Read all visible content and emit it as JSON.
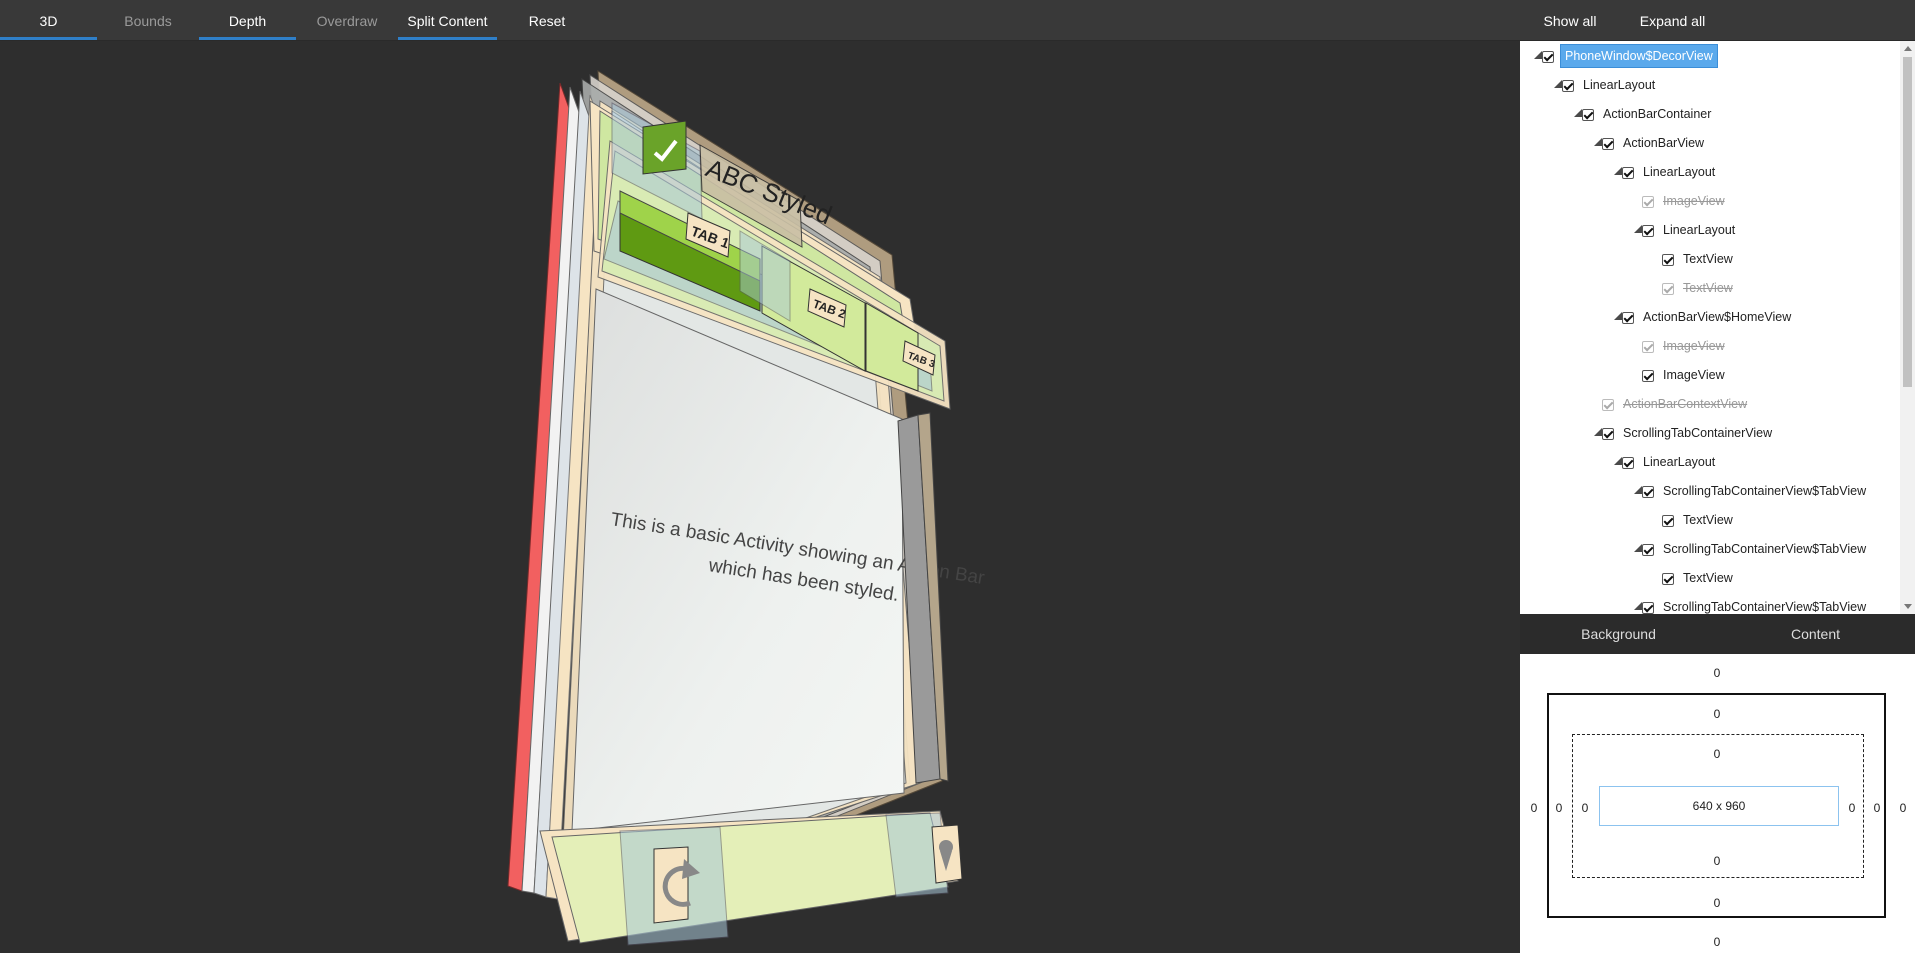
{
  "toolbar": {
    "left_buttons": [
      {
        "label": "3D",
        "active": true
      },
      {
        "label": "Bounds",
        "active": false
      },
      {
        "label": "Depth",
        "active": true
      },
      {
        "label": "Overdraw",
        "active": false
      },
      {
        "label": "Split Content",
        "active": true
      },
      {
        "label": "Reset",
        "active": false
      }
    ],
    "show_all": "Show all",
    "expand_all": "Expand all"
  },
  "scene": {
    "title": "ABC Styled",
    "tabs": [
      "TAB 1",
      "TAB 2",
      "TAB 3"
    ],
    "body_line1": "This is a basic Activity showing an Action Bar",
    "body_line2": "which has been styled."
  },
  "tree": {
    "nodes": [
      {
        "label": "PhoneWindow$DecorView",
        "depth": 0,
        "expandable": true,
        "checked": true,
        "hidden": false,
        "selected": true
      },
      {
        "label": "LinearLayout",
        "depth": 1,
        "expandable": true,
        "checked": true,
        "hidden": false
      },
      {
        "label": "ActionBarContainer",
        "depth": 2,
        "expandable": true,
        "checked": true,
        "hidden": false
      },
      {
        "label": "ActionBarView",
        "depth": 3,
        "expandable": true,
        "checked": true,
        "hidden": false
      },
      {
        "label": "LinearLayout",
        "depth": 4,
        "expandable": true,
        "checked": true,
        "hidden": false
      },
      {
        "label": "ImageView",
        "depth": 5,
        "expandable": false,
        "checked": true,
        "hidden": true
      },
      {
        "label": "LinearLayout",
        "depth": 5,
        "expandable": true,
        "checked": true,
        "hidden": false
      },
      {
        "label": "TextView",
        "depth": 6,
        "expandable": false,
        "checked": true,
        "hidden": false
      },
      {
        "label": "TextView",
        "depth": 6,
        "expandable": false,
        "checked": true,
        "hidden": true
      },
      {
        "label": "ActionBarView$HomeView",
        "depth": 4,
        "expandable": true,
        "checked": true,
        "hidden": false
      },
      {
        "label": "ImageView",
        "depth": 5,
        "expandable": false,
        "checked": true,
        "hidden": true
      },
      {
        "label": "ImageView",
        "depth": 5,
        "expandable": false,
        "checked": true,
        "hidden": false
      },
      {
        "label": "ActionBarContextView",
        "depth": 3,
        "expandable": false,
        "checked": true,
        "hidden": true
      },
      {
        "label": "ScrollingTabContainerView",
        "depth": 3,
        "expandable": true,
        "checked": true,
        "hidden": false
      },
      {
        "label": "LinearLayout",
        "depth": 4,
        "expandable": true,
        "checked": true,
        "hidden": false
      },
      {
        "label": "ScrollingTabContainerView$TabView",
        "depth": 5,
        "expandable": true,
        "checked": true,
        "hidden": false
      },
      {
        "label": "TextView",
        "depth": 6,
        "expandable": false,
        "checked": true,
        "hidden": false
      },
      {
        "label": "ScrollingTabContainerView$TabView",
        "depth": 5,
        "expandable": true,
        "checked": true,
        "hidden": false
      },
      {
        "label": "TextView",
        "depth": 6,
        "expandable": false,
        "checked": true,
        "hidden": false
      },
      {
        "label": "ScrollingTabContainerView$TabView",
        "depth": 5,
        "expandable": true,
        "checked": true,
        "hidden": false
      }
    ]
  },
  "box_tabs": {
    "background": "Background",
    "content": "Content"
  },
  "box_model": {
    "margin": {
      "top": "0",
      "right": "0",
      "bottom": "0",
      "left": "0"
    },
    "border": {
      "top": "0",
      "right": "0",
      "bottom": "0",
      "left": "0"
    },
    "padding": {
      "top": "0",
      "right": "0",
      "bottom": "0",
      "left": "0"
    },
    "size": "640 x 960"
  },
  "colors": {
    "accent": "#2f7fc8",
    "selection": "#5aa9ec",
    "layer_green": "#9fd34a",
    "layer_green_dark": "#5f9a12",
    "layer_beige": "#f6e4c3",
    "layer_red": "#f26060",
    "layer_blue": "#a9c8d8"
  }
}
